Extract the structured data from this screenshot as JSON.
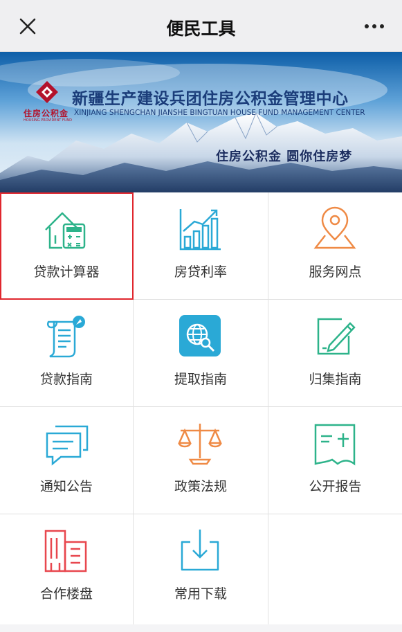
{
  "header": {
    "title": "便民工具",
    "close_icon": "close-icon",
    "more_icon": "more-icon"
  },
  "banner": {
    "logo_text": "住房公积金",
    "logo_sub": "HOUSING PROVIDENT FUND",
    "org_name_cn": "新疆生产建设兵团住房公积金管理中心",
    "org_name_en": "XINJIANG SHENGCHAN JIANSHE BINGTUAN HOUSE FUND MANAGEMENT CENTER",
    "slogan": "住房公积金  圆你住房梦"
  },
  "tools": [
    {
      "label": "贷款计算器",
      "icon": "loan-calculator-icon",
      "color": "#2db38a",
      "selected": true
    },
    {
      "label": "房贷利率",
      "icon": "rate-chart-icon",
      "color": "#2aa9d6"
    },
    {
      "label": "服务网点",
      "icon": "location-pin-icon",
      "color": "#ef8a45"
    },
    {
      "label": "贷款指南",
      "icon": "loan-guide-icon",
      "color": "#2aa9d6"
    },
    {
      "label": "提取指南",
      "icon": "globe-search-icon",
      "color": "#2aa9d6"
    },
    {
      "label": "归集指南",
      "icon": "edit-document-icon",
      "color": "#2db38a"
    },
    {
      "label": "通知公告",
      "icon": "message-icon",
      "color": "#2aa9d6"
    },
    {
      "label": "政策法规",
      "icon": "scales-icon",
      "color": "#ef8a45"
    },
    {
      "label": "公开报告",
      "icon": "report-icon",
      "color": "#2db38a"
    },
    {
      "label": "合作楼盘",
      "icon": "building-icon",
      "color": "#e8474e"
    },
    {
      "label": "常用下载",
      "icon": "download-icon",
      "color": "#2aa9d6"
    }
  ],
  "colors": {
    "selection_outline": "#e0272e",
    "brand_red": "#b3122b",
    "brand_blue": "#1b3d7a"
  }
}
